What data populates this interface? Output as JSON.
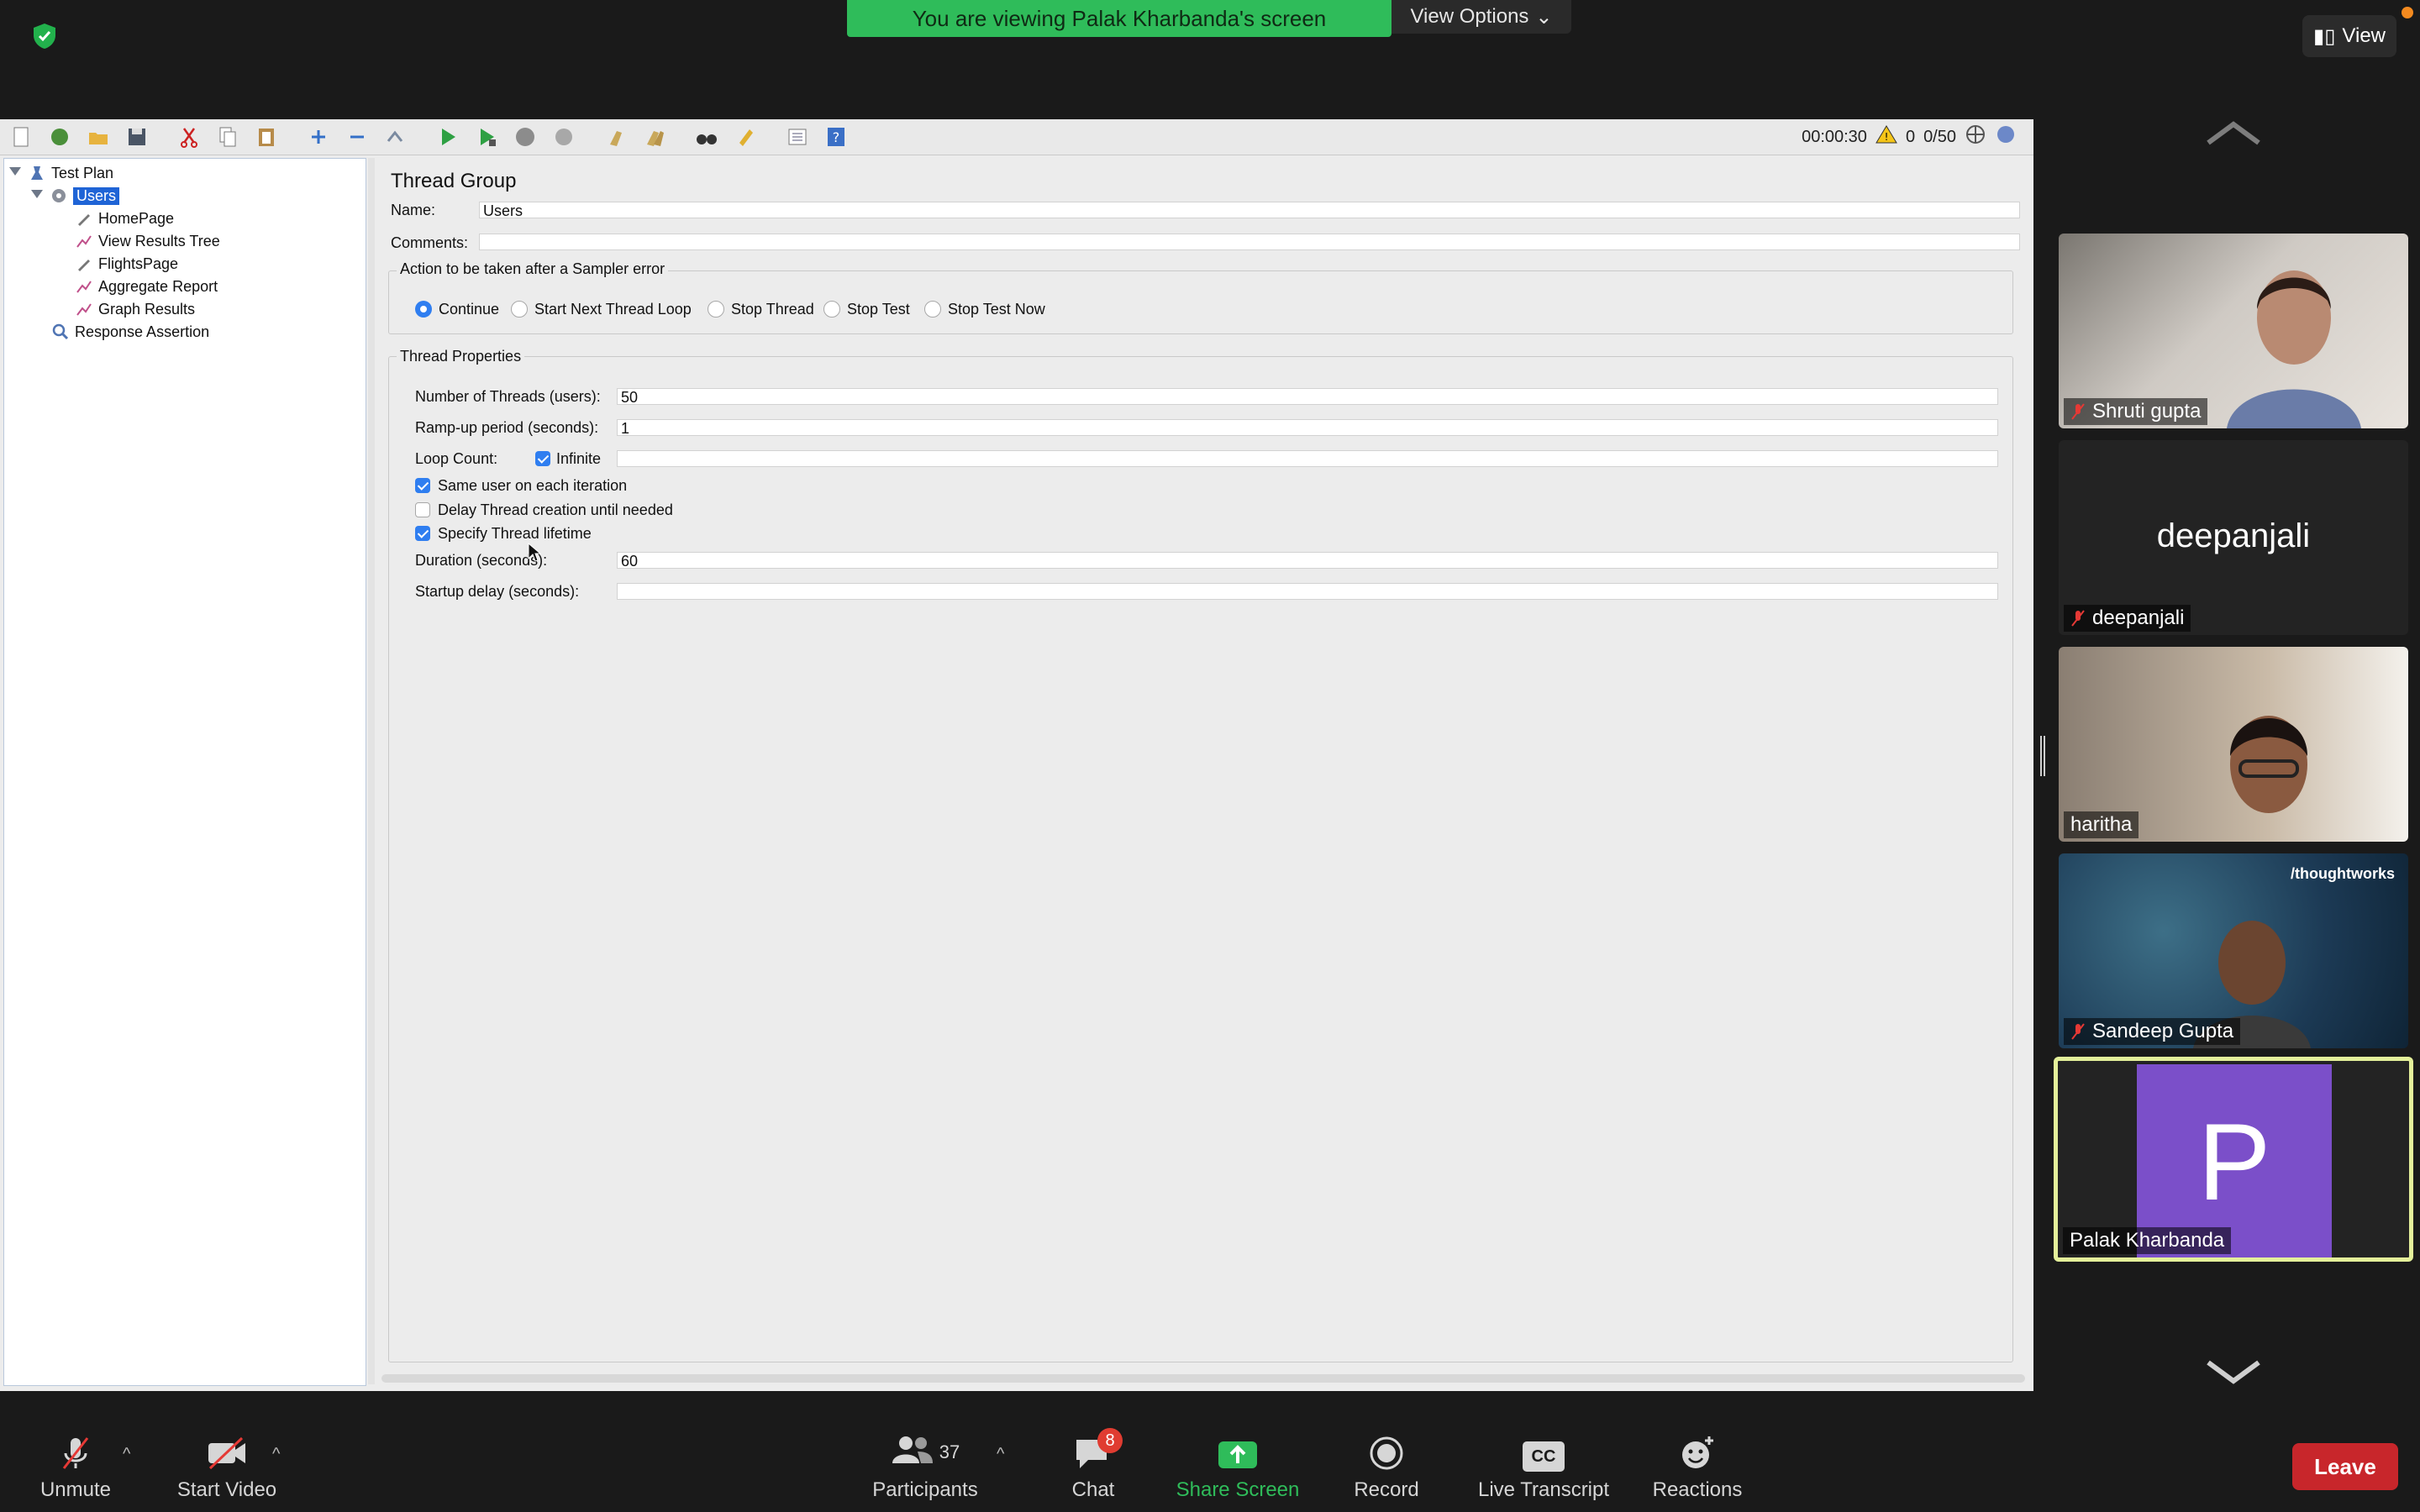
{
  "top_bar": {
    "banner_text": "You are viewing Palak Kharbanda's screen",
    "view_options_label": "View Options",
    "view_button_label": "View"
  },
  "jmeter": {
    "status": {
      "elapsed": "00:00:30",
      "warnings": "0",
      "threads": "0/50"
    },
    "tree": {
      "items": [
        {
          "label": "Test Plan",
          "icon": "test-plan-icon"
        },
        {
          "label": "Users",
          "icon": "gear-icon"
        },
        {
          "label": "HomePage",
          "icon": "pipette-icon"
        },
        {
          "label": "View Results Tree",
          "icon": "graph-icon"
        },
        {
          "label": "FlightsPage",
          "icon": "pipette-icon"
        },
        {
          "label": "Aggregate Report",
          "icon": "graph-icon"
        },
        {
          "label": "Graph Results",
          "icon": "graph-icon"
        },
        {
          "label": "Response Assertion",
          "icon": "magnifier-icon"
        }
      ]
    },
    "panel": {
      "title": "Thread Group",
      "name_label": "Name:",
      "name_value": "Users",
      "comments_label": "Comments:",
      "comments_value": "",
      "sampler_error_title": "Action to be taken after a Sampler error",
      "sampler_options": [
        "Continue",
        "Start Next Thread Loop",
        "Stop Thread",
        "Stop Test",
        "Stop Test Now"
      ],
      "sampler_selected": "Continue",
      "thread_props_title": "Thread Properties",
      "threads_label": "Number of Threads (users):",
      "threads_value": "50",
      "rampup_label": "Ramp-up period (seconds):",
      "rampup_value": "1",
      "loop_label": "Loop Count:",
      "infinite_label": "Infinite",
      "loop_value": "",
      "same_user_label": "Same user on each iteration",
      "delay_label": "Delay Thread creation until needed",
      "lifetime_label": "Specify Thread lifetime",
      "duration_label": "Duration (seconds):",
      "duration_value": "60",
      "startup_label": "Startup delay (seconds):",
      "startup_value": ""
    }
  },
  "participants": [
    {
      "name": "Shruti gupta",
      "muted": true,
      "video": "photo"
    },
    {
      "name": "deepanjali",
      "muted": true,
      "video": "none",
      "display": "deepanjali"
    },
    {
      "name": "haritha",
      "muted": false,
      "video": "photo"
    },
    {
      "name": "Sandeep Gupta",
      "muted": true,
      "video": "photo",
      "background_text": "/thoughtworks"
    },
    {
      "name": "Palak Kharbanda",
      "muted": false,
      "video": "avatar",
      "initial": "P",
      "avatar_color": "#7b4fc9",
      "highlight": "#e4f09a"
    }
  ],
  "bottom_bar": {
    "unmute": "Unmute",
    "start_video": "Start Video",
    "participants": "Participants",
    "participants_count": "37",
    "chat": "Chat",
    "chat_badge": "8",
    "share_screen": "Share Screen",
    "record": "Record",
    "live_transcript": "Live Transcript",
    "cc": "CC",
    "reactions": "Reactions",
    "leave": "Leave"
  }
}
